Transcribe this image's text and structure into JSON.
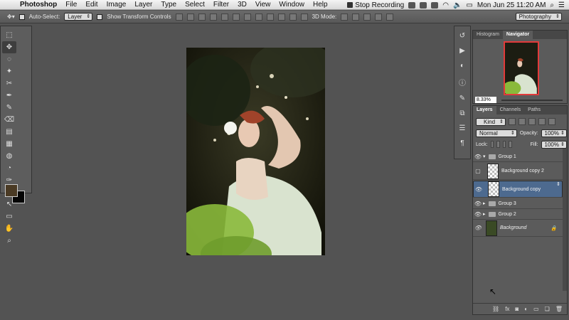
{
  "menubar": {
    "apple": "",
    "app_name": "Photoshop",
    "items": [
      "File",
      "Edit",
      "Image",
      "Layer",
      "Type",
      "Select",
      "Filter",
      "3D",
      "View",
      "Window",
      "Help"
    ],
    "status": {
      "recording": "Stop Recording",
      "clock": "Mon Jun 25  11:20 AM"
    }
  },
  "options_bar": {
    "auto_select_label": "Auto-Select:",
    "auto_select_value": "Layer",
    "show_transform_label": "Show Transform Controls",
    "mode_3d_label": "3D Mode:",
    "workspace": "Photography"
  },
  "tools": [
    "⬚",
    "✥",
    "◌",
    "✦",
    "✂",
    "✒",
    "✎",
    "⌫",
    "▤",
    "▦",
    "◍",
    "◔",
    "✑",
    "T",
    "↖",
    "▭",
    "✋",
    "⌕"
  ],
  "colors": {
    "foreground": "#4a3a24",
    "background": "#050505",
    "accent_selected": "#4d6a8f",
    "nav_frame": "#e23a3a"
  },
  "navigator": {
    "tabs": [
      "Histogram",
      "Navigator"
    ],
    "active_tab": "Navigator",
    "zoom": "8.33%"
  },
  "layers_panel": {
    "tabs": [
      "Layers",
      "Channels",
      "Paths"
    ],
    "active_tab": "Layers",
    "filter_kind": "Kind",
    "blend_mode": "Normal",
    "opacity_label": "Opacity:",
    "opacity_value": "100%",
    "lock_label": "Lock:",
    "fill_label": "Fill:",
    "fill_value": "100%",
    "layers": [
      {
        "name": "Group 1",
        "type": "group-open",
        "visible": true
      },
      {
        "name": "Background copy 2",
        "type": "layer",
        "visible": false
      },
      {
        "name": "Background copy",
        "type": "layer",
        "visible": true,
        "selected": true
      },
      {
        "name": "Group 3",
        "type": "group",
        "visible": true
      },
      {
        "name": "Group 2",
        "type": "group",
        "visible": true
      },
      {
        "name": "Background",
        "type": "background",
        "visible": true
      }
    ]
  }
}
